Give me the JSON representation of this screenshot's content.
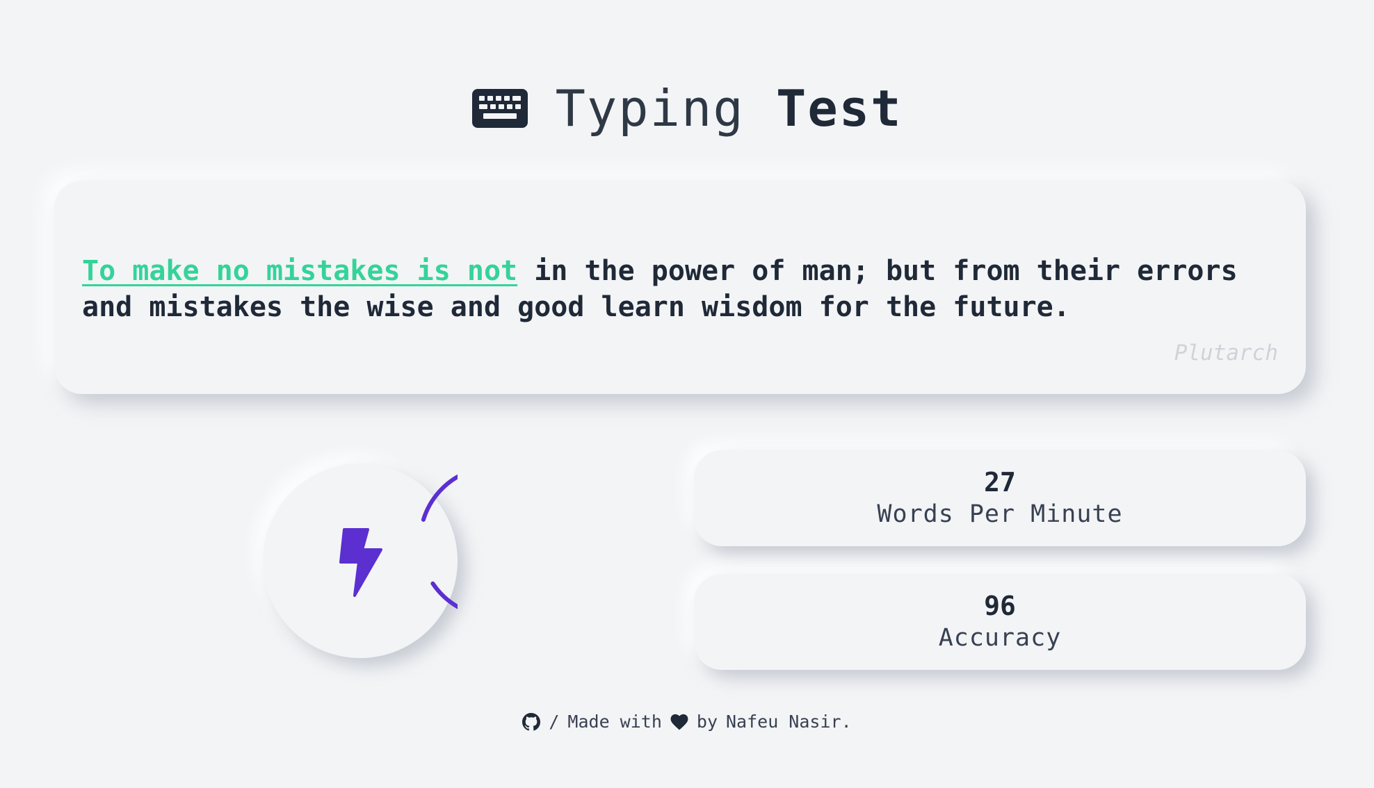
{
  "header": {
    "icon": "keyboard-icon",
    "title_light": "Typing",
    "title_bold": "Test"
  },
  "quote": {
    "typed_text": "To make no mistakes is not",
    "remaining_text": " in the power of man; but from their errors and mistakes the wise and good learn wisdom for the future.",
    "author": "Plutarch"
  },
  "speed_badge": {
    "icon": "lightning-bolt-icon",
    "accent_color": "#5b2fd0"
  },
  "stats": {
    "wpm_value": "27",
    "wpm_label": "Words Per Minute",
    "accuracy_value": "96",
    "accuracy_label": "Accuracy"
  },
  "footer": {
    "github_icon": "github-icon",
    "separator": "/",
    "made_with": "Made with",
    "heart_icon": "heart-icon",
    "by_text": "by",
    "author": "Nafeu Nasir."
  },
  "colors": {
    "background": "#f3f4f6",
    "typed_text": "#34d399",
    "text": "#1f2937",
    "author": "#cfd3d9",
    "accent": "#5b2fd0"
  }
}
